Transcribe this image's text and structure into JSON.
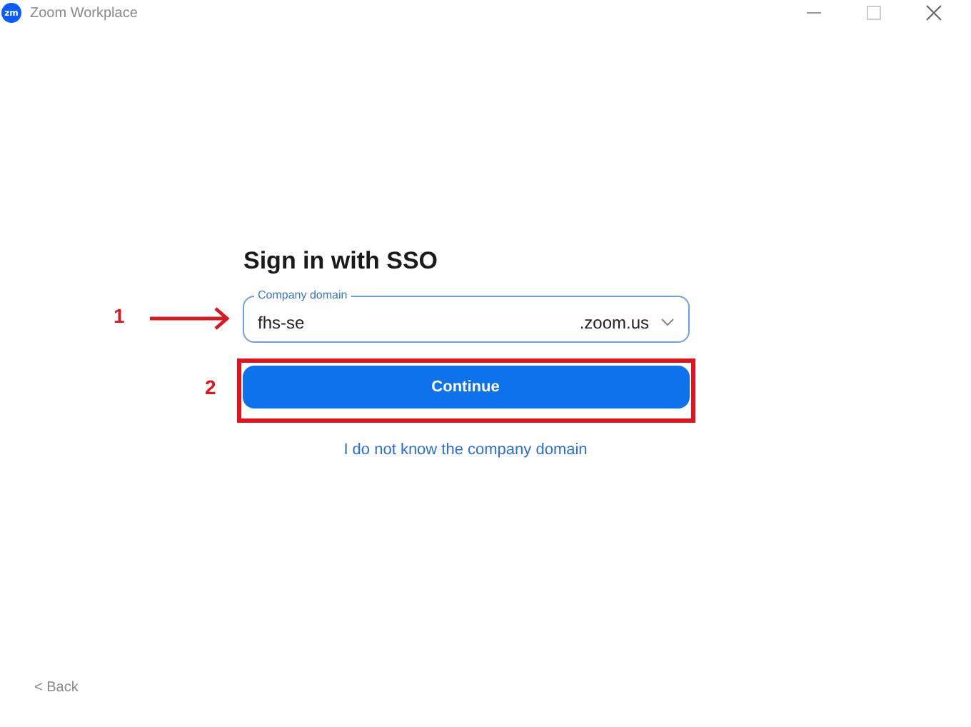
{
  "window": {
    "title": "Zoom Workplace",
    "app_icon_text": "zm"
  },
  "heading": "Sign in with SSO",
  "domain_field": {
    "label": "Company domain",
    "value": "fhs-se",
    "suffix": ".zoom.us"
  },
  "continue_button": "Continue",
  "help_link": "I do not know the company domain",
  "back_link": "< Back",
  "annotations": [
    {
      "kind": "arrow",
      "number": "1"
    },
    {
      "kind": "frame",
      "number": "2"
    }
  ]
}
